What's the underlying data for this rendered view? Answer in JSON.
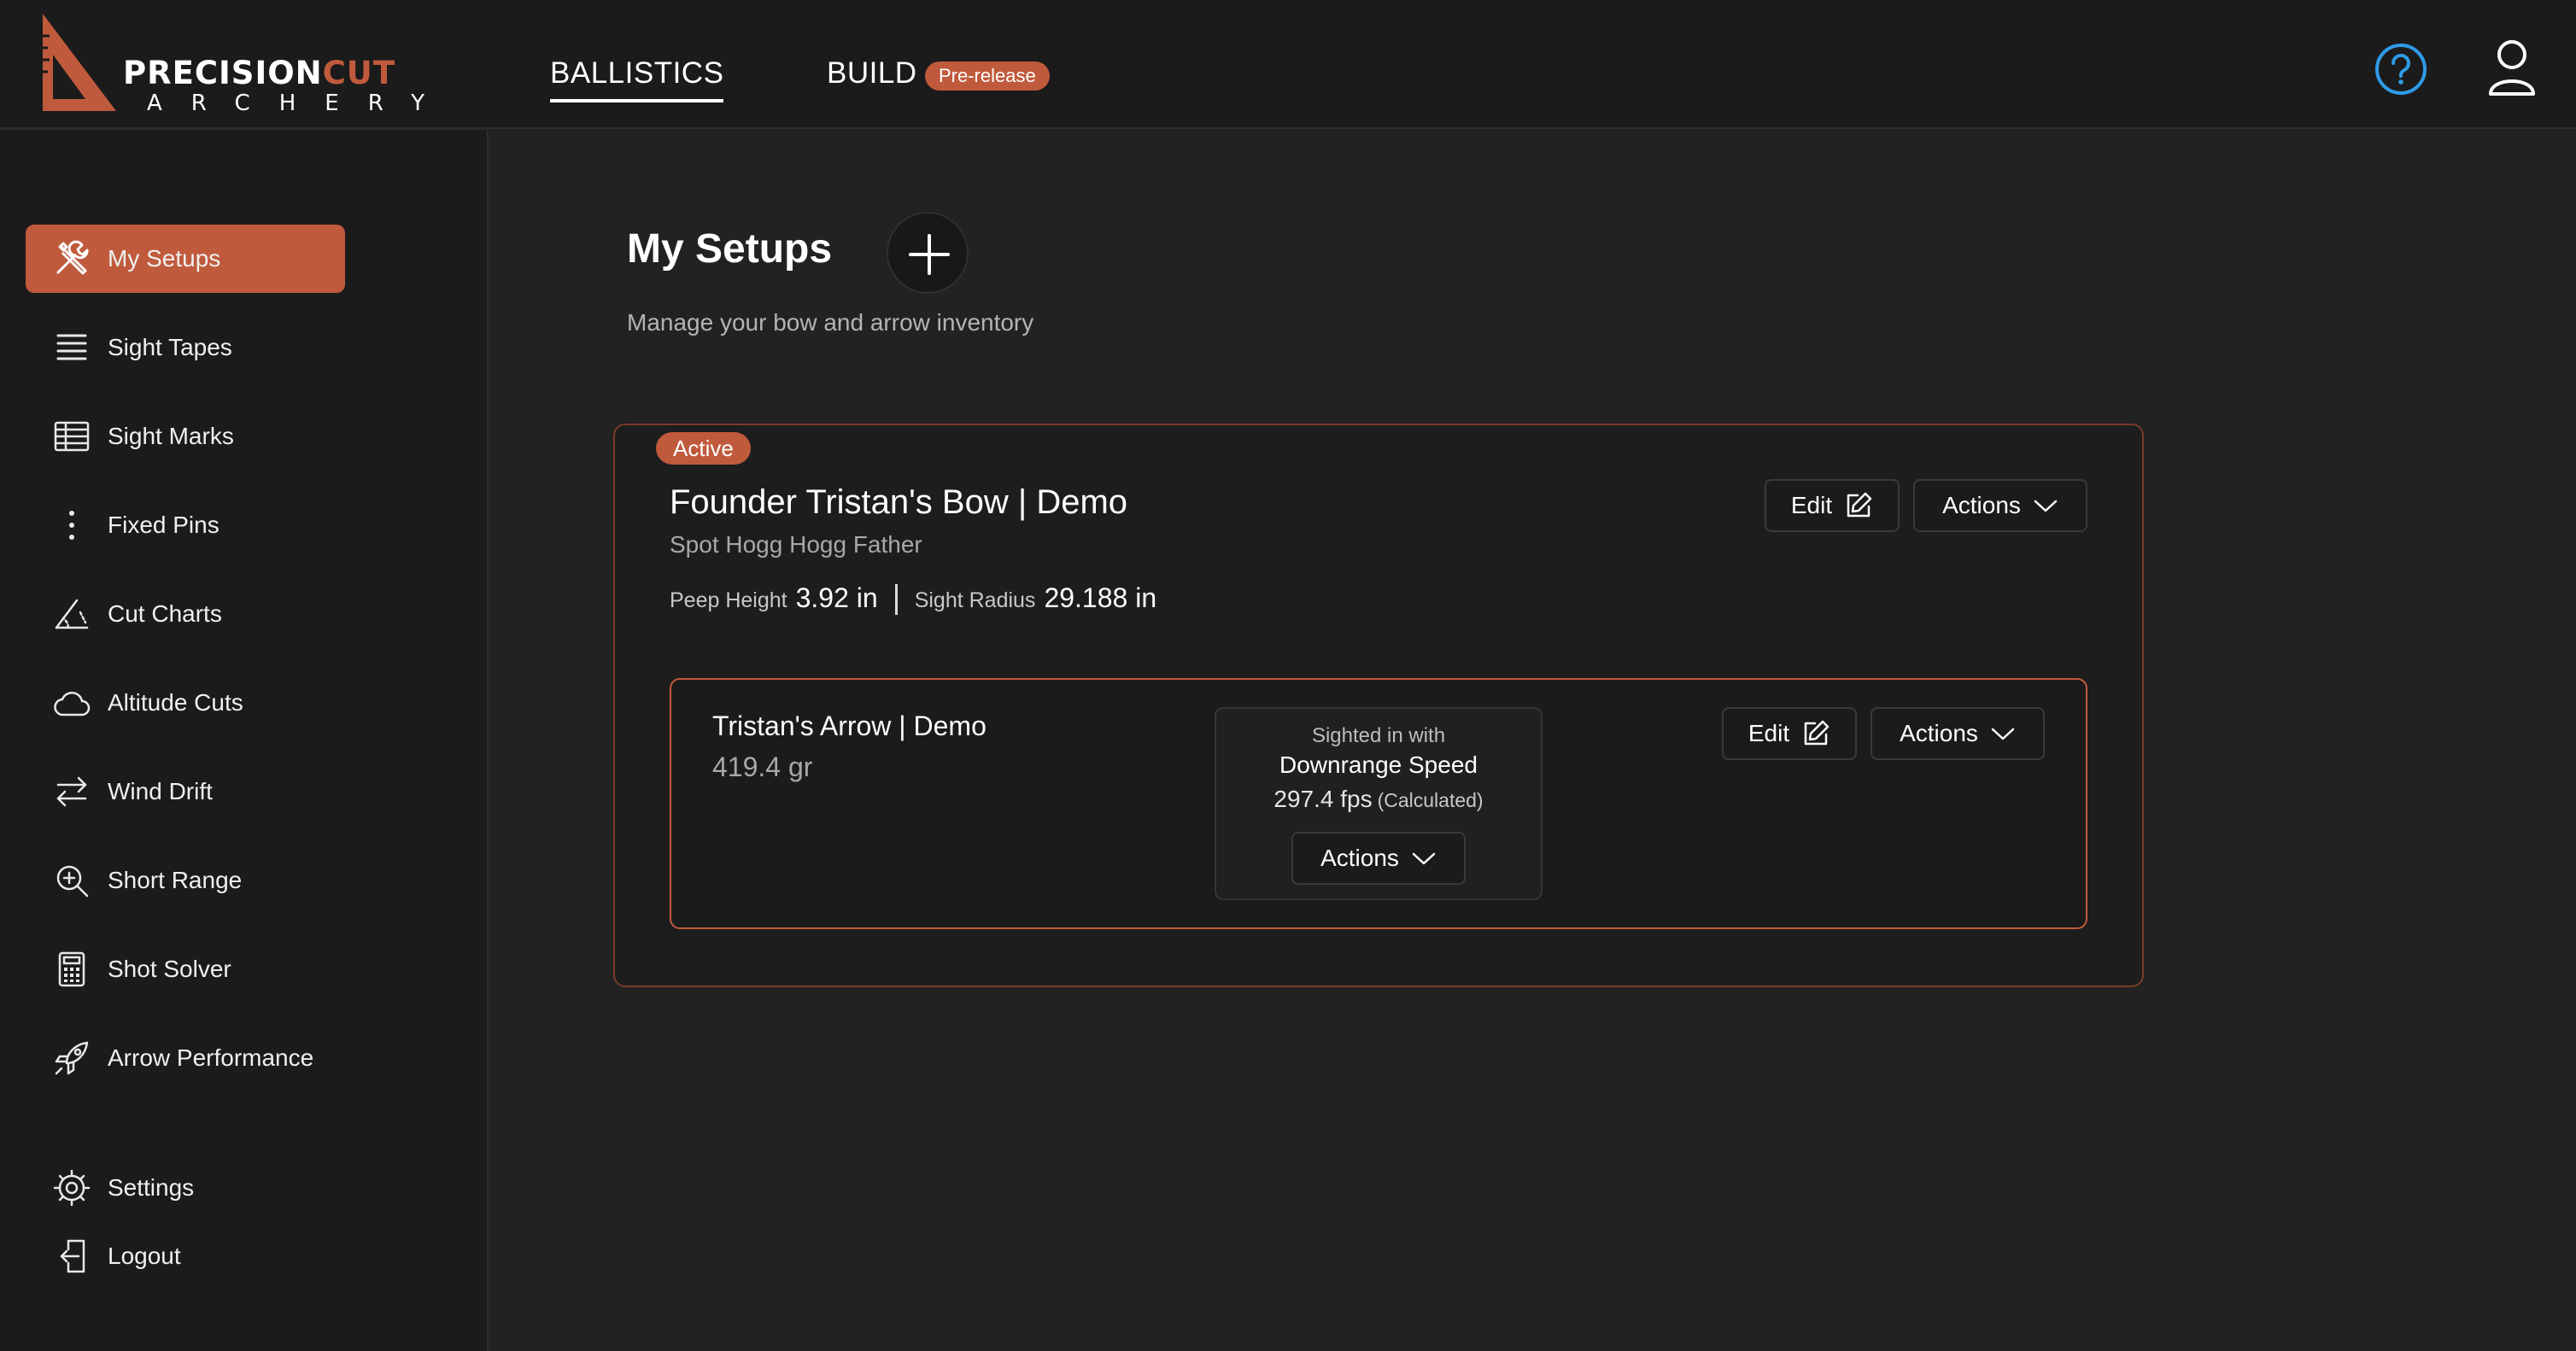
{
  "brand": {
    "name_part1": "PRECISION",
    "name_part2": "CUT",
    "sub": "ARCHERY",
    "accent_color": "#c05a3c"
  },
  "topnav": {
    "ballistics": "BALLISTICS",
    "build": "BUILD",
    "build_badge": "Pre-release",
    "help_icon": "help-circle-icon",
    "user_icon": "user-icon"
  },
  "sidebar": {
    "items": [
      {
        "label": "My Setups",
        "icon": "tools-icon",
        "active": true
      },
      {
        "label": "Sight Tapes",
        "icon": "lines-icon"
      },
      {
        "label": "Sight Marks",
        "icon": "table-icon"
      },
      {
        "label": "Fixed Pins",
        "icon": "dots-vertical-icon"
      },
      {
        "label": "Cut Charts",
        "icon": "angle-icon"
      },
      {
        "label": "Altitude Cuts",
        "icon": "cloud-icon"
      },
      {
        "label": "Wind Drift",
        "icon": "arrows-swap-icon"
      },
      {
        "label": "Short Range",
        "icon": "zoom-in-icon"
      },
      {
        "label": "Shot Solver",
        "icon": "calculator-icon"
      },
      {
        "label": "Arrow Performance",
        "icon": "rocket-icon"
      }
    ],
    "settings": "Settings",
    "logout": "Logout"
  },
  "main": {
    "title": "My Setups",
    "subtitle": "Manage your bow and arrow inventory"
  },
  "setup": {
    "status": "Active",
    "bow_name": "Founder Tristan's Bow | Demo",
    "bow_model": "Spot Hogg Hogg Father",
    "peep_label": "Peep Height",
    "peep_value": "3.92 in",
    "radius_label": "Sight Radius",
    "radius_value": "29.188 in",
    "edit_label": "Edit",
    "actions_label": "Actions",
    "arrow": {
      "name": "Tristan's Arrow | Demo",
      "weight": "419.4 gr",
      "sighted_caption": "Sighted in with",
      "sighted_method": "Downrange Speed",
      "speed": "297.4 fps",
      "speed_note": "(Calculated)",
      "edit_label": "Edit",
      "actions_label": "Actions",
      "sight_actions_label": "Actions"
    }
  }
}
